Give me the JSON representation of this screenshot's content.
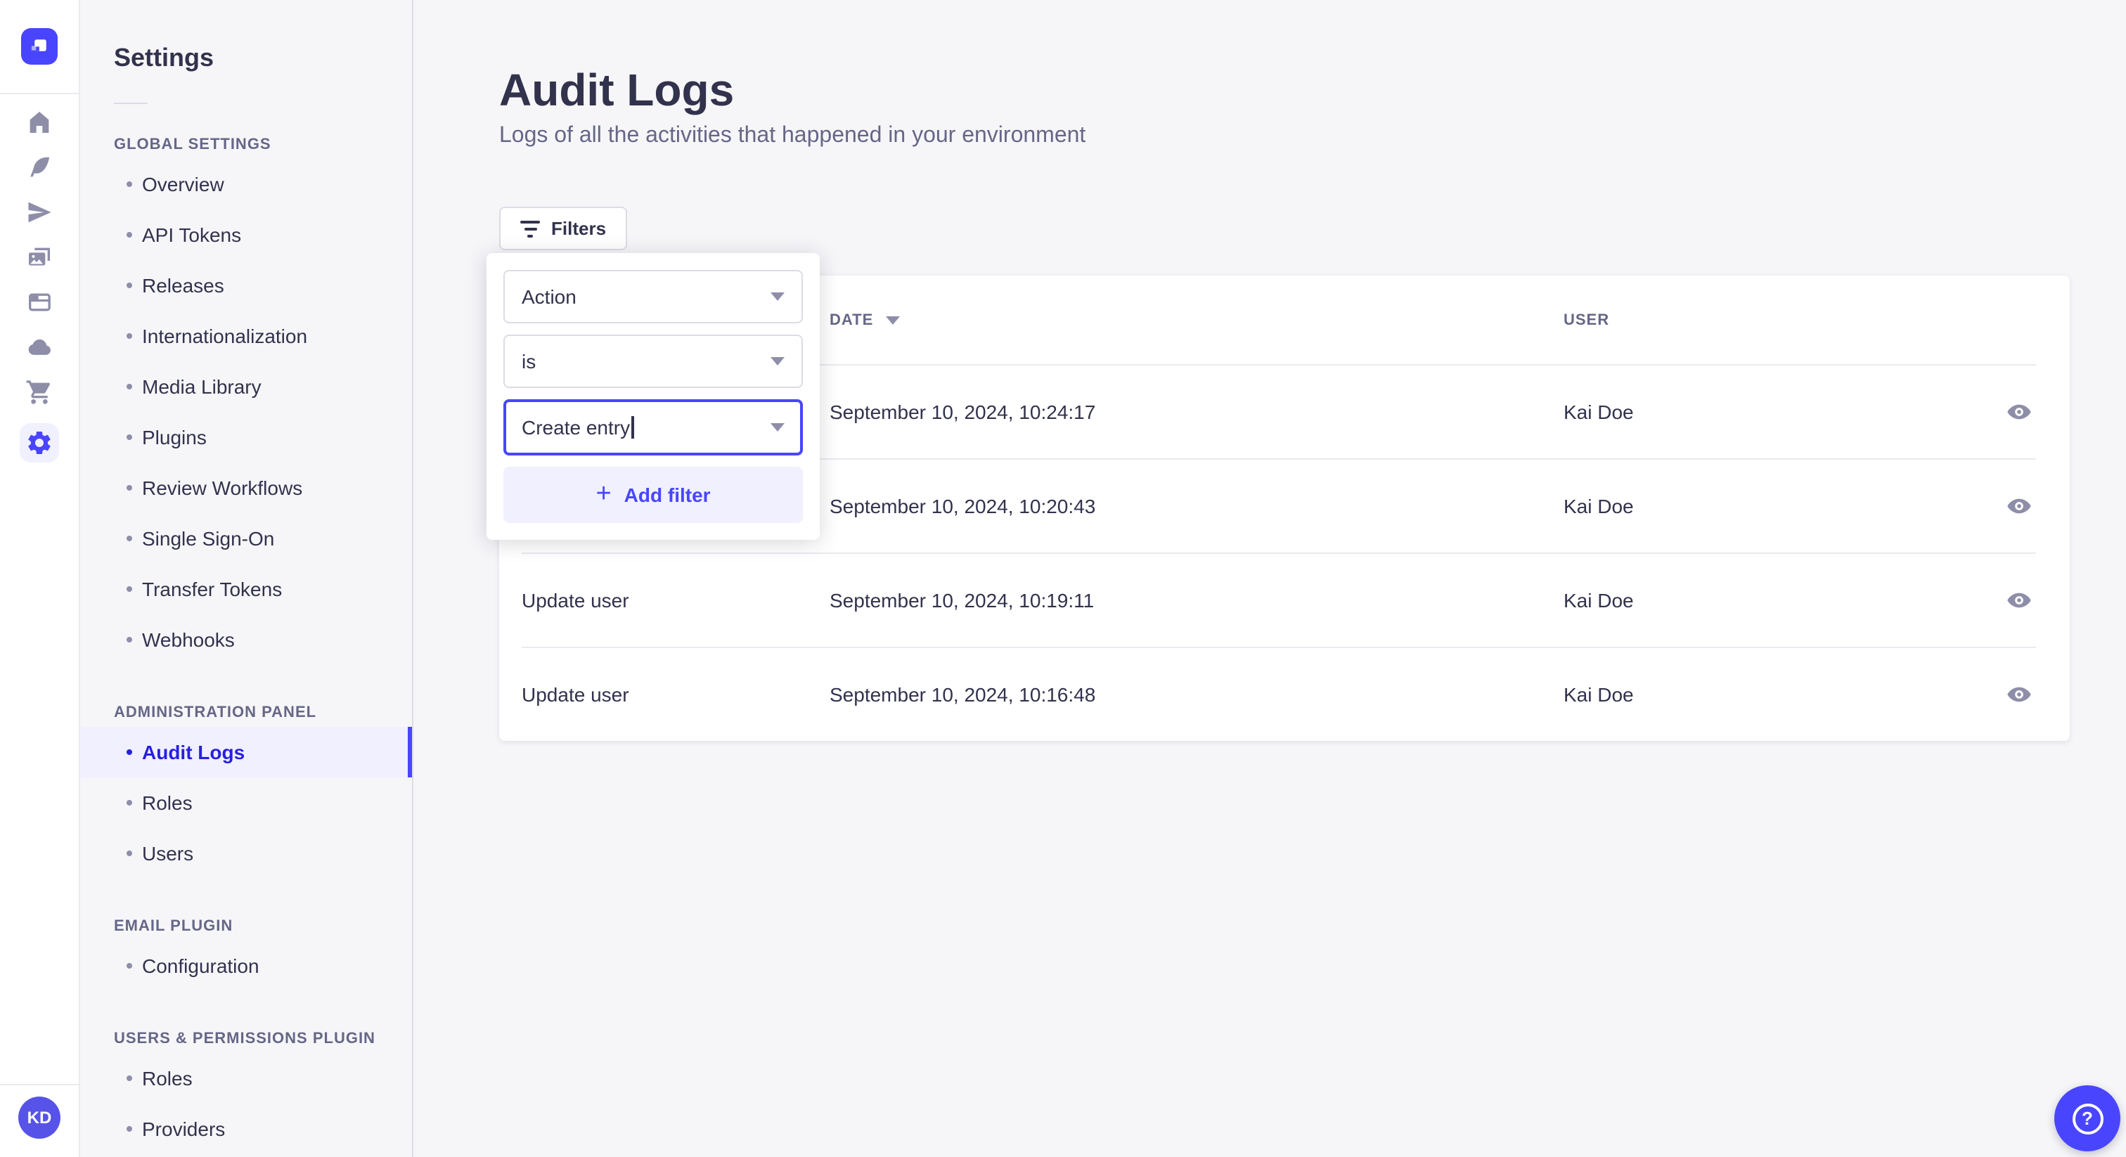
{
  "colors": {
    "primary": "#4945FF",
    "primary_soft": "#F0F0FF",
    "selected_text": "#271FE0",
    "text_dark": "#32324D",
    "text_muted": "#666687",
    "icon_gray": "#8E8EA9",
    "border": "#DCDCE4",
    "divider": "#EAEAEF",
    "page_bg": "#F6F6F9",
    "card_bg": "#FFFFFF"
  },
  "rail": {
    "logo_icon": "strapi-logo-icon",
    "nav_icons": [
      "home-icon",
      "feather-icon",
      "paper-plane-icon",
      "media-library-icon",
      "layout-icon",
      "cloud-icon",
      "cart-icon",
      "settings-gear-icon"
    ],
    "active_icon": "settings-gear-icon",
    "avatar_initials": "KD"
  },
  "sidebar": {
    "title": "Settings",
    "sections": [
      {
        "label": "GLOBAL SETTINGS",
        "items": [
          {
            "label": "Overview"
          },
          {
            "label": "API Tokens"
          },
          {
            "label": "Releases"
          },
          {
            "label": "Internationalization"
          },
          {
            "label": "Media Library"
          },
          {
            "label": "Plugins"
          },
          {
            "label": "Review Workflows"
          },
          {
            "label": "Single Sign-On"
          },
          {
            "label": "Transfer Tokens"
          },
          {
            "label": "Webhooks"
          }
        ]
      },
      {
        "label": "ADMINISTRATION PANEL",
        "items": [
          {
            "label": "Audit Logs",
            "active": true
          },
          {
            "label": "Roles"
          },
          {
            "label": "Users"
          }
        ]
      },
      {
        "label": "EMAIL PLUGIN",
        "items": [
          {
            "label": "Configuration"
          }
        ]
      },
      {
        "label": "USERS & PERMISSIONS PLUGIN",
        "items": [
          {
            "label": "Roles"
          },
          {
            "label": "Providers"
          }
        ]
      }
    ]
  },
  "header": {
    "title": "Audit Logs",
    "subtitle": "Logs of all the activities that happened in your environment"
  },
  "filters": {
    "button_label": "Filters",
    "button_icon": "filter-icon",
    "popup": {
      "field_value": "Action",
      "operator_value": "is",
      "action_value": "Create entry",
      "add_filter_label": "Add filter",
      "plus_icon": "plus-icon",
      "chevron_icon": "chevron-down-icon"
    }
  },
  "table": {
    "columns": [
      {
        "label": "DATE",
        "sorted": true,
        "sort_icon": "sort-descending-icon"
      },
      {
        "label": "USER"
      }
    ],
    "row_action_icon": "eye-icon",
    "rows": [
      {
        "action": "",
        "date": "September 10, 2024, 10:24:17",
        "user": "Kai Doe"
      },
      {
        "action": "",
        "date": "September 10, 2024, 10:20:43",
        "user": "Kai Doe"
      },
      {
        "action": "Update user",
        "date": "September 10, 2024, 10:19:11",
        "user": "Kai Doe"
      },
      {
        "action": "Update user",
        "date": "September 10, 2024, 10:16:48",
        "user": "Kai Doe"
      }
    ]
  },
  "help": {
    "icon": "question-mark-icon"
  }
}
